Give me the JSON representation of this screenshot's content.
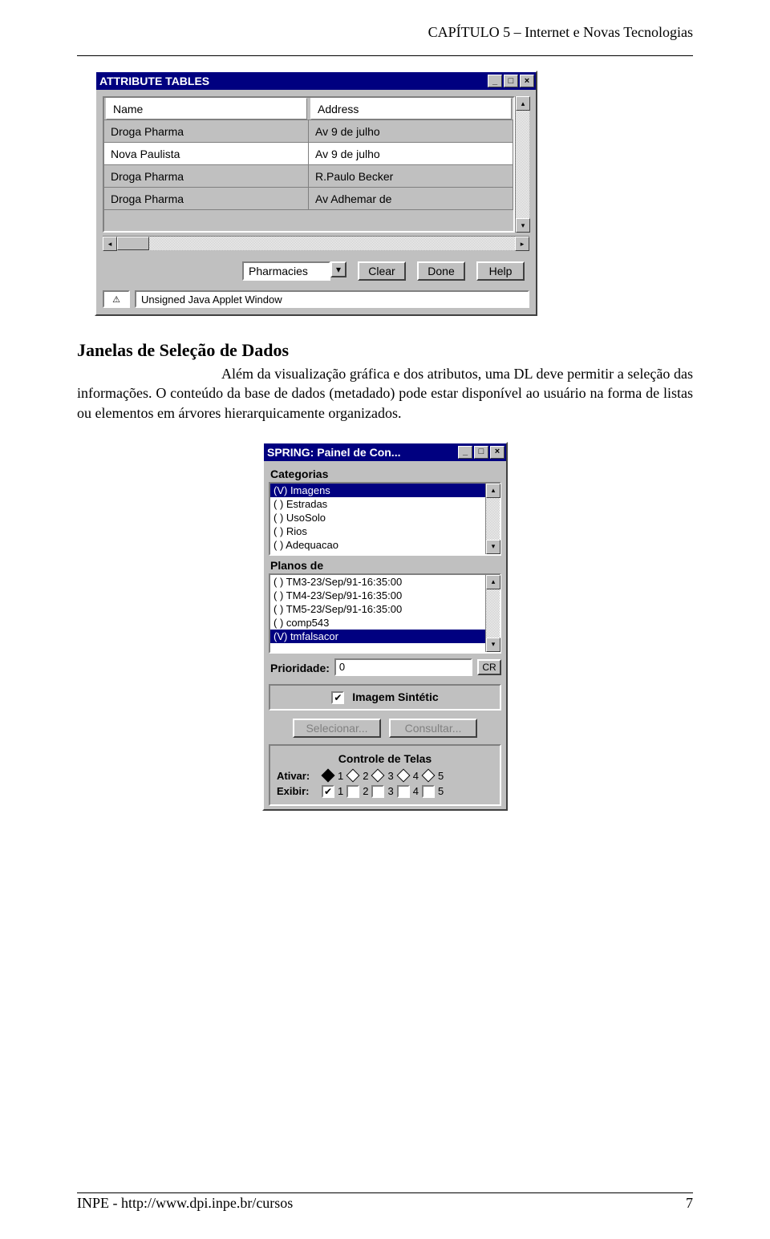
{
  "header": {
    "chapter": "CAPÍTULO 5 – Internet e Novas Tecnologias"
  },
  "attr_window": {
    "title": "ATTRIBUTE TABLES",
    "columns": [
      "Name",
      "Address"
    ],
    "rows": [
      {
        "c0": "Droga Pharma",
        "c1": "Av 9 de julho"
      },
      {
        "c0": "Nova Paulista",
        "c1": "Av 9 de julho"
      },
      {
        "c0": "Droga Pharma",
        "c1": "R.Paulo Becker"
      },
      {
        "c0": "Droga Pharma",
        "c1": "Av Adhemar de"
      }
    ],
    "selected_row": 1,
    "dropdown_value": "Pharmacies",
    "buttons": {
      "clear": "Clear",
      "done": "Done",
      "help": "Help"
    },
    "status_icon": "⚠",
    "status_text": "Unsigned Java Applet Window"
  },
  "article": {
    "heading": "Janelas de Seleção de Dados",
    "body": "Além da visualização gráfica e dos atributos, uma DL deve permitir a seleção das informações. O conteúdo da base de dados (metadado) pode estar disponível ao usuário na forma de listas ou elementos em árvores hierarquicamente organizados."
  },
  "spring_window": {
    "title": "SPRING: Painel de Con...",
    "categorias_label": "Categorias",
    "categorias": [
      {
        "text": "(V) Imagens",
        "selected": true
      },
      {
        "text": "( ) Estradas"
      },
      {
        "text": "( ) UsoSolo"
      },
      {
        "text": "( ) Rios"
      },
      {
        "text": "( ) Adequacao"
      }
    ],
    "planos_label": "Planos de",
    "planos": [
      {
        "text": "( ) TM3-23/Sep/91-16:35:00"
      },
      {
        "text": "( ) TM4-23/Sep/91-16:35:00"
      },
      {
        "text": "( ) TM5-23/Sep/91-16:35:00"
      },
      {
        "text": "( ) comp543"
      },
      {
        "text": "(V) tmfalsacor",
        "selected": true
      }
    ],
    "prioridade_label": "Prioridade:",
    "prioridade_value": "0",
    "cr_label": "CR",
    "imagem_sint_label": "Imagem Sintétic",
    "imagem_sint_checked": true,
    "selecionar_label": "Selecionar...",
    "consultar_label": "Consultar...",
    "controle_label": "Controle de Telas",
    "ativar_label": "Ativar:",
    "ativar_options": [
      "1",
      "2",
      "3",
      "4",
      "5"
    ],
    "ativar_selected": 0,
    "exibir_label": "Exibir:",
    "exibir_options": [
      "1",
      "2",
      "3",
      "4",
      "5"
    ],
    "exibir_checked": [
      true,
      false,
      false,
      false,
      false
    ]
  },
  "footer": {
    "left": "INPE - http://www.dpi.inpe.br/cursos",
    "page": "7"
  }
}
